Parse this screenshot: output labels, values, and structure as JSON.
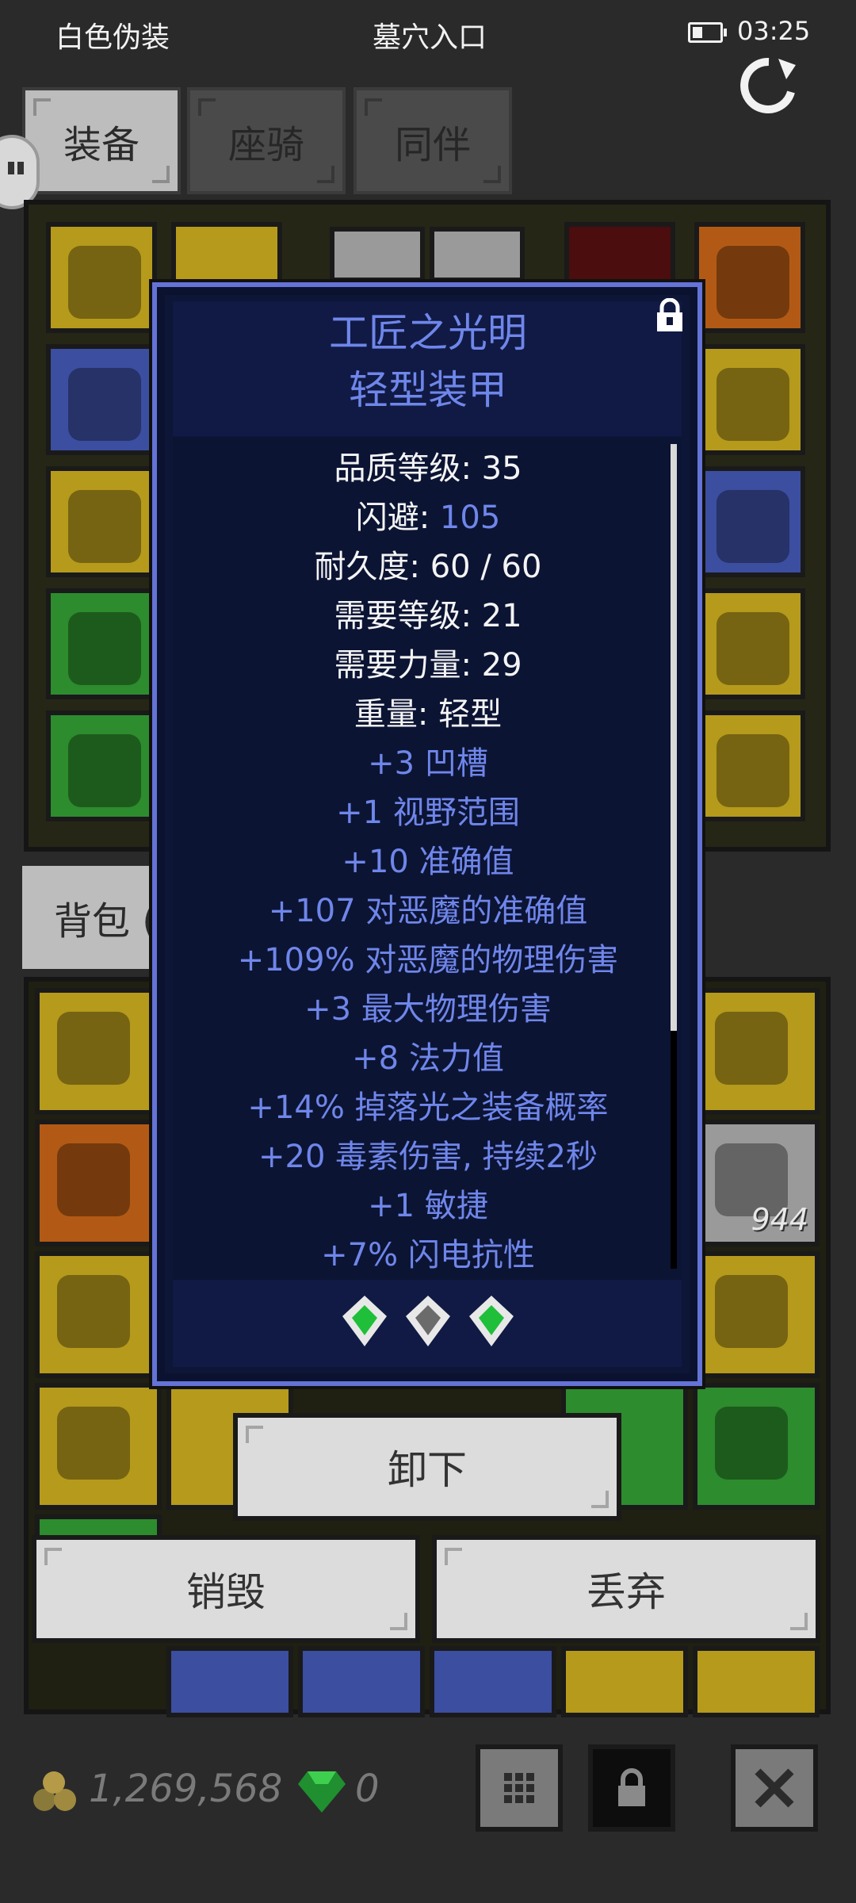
{
  "status_bar": {
    "left_text": "白色伪装",
    "center_text": "墓穴入口",
    "time": "03:25"
  },
  "tabs": [
    {
      "label": "装备",
      "active": true
    },
    {
      "label": "座骑",
      "active": false
    },
    {
      "label": "同伴",
      "active": false
    }
  ],
  "backpack_tab": {
    "label": "背包 ("
  },
  "backpack_items": {
    "fish_quantity": "944"
  },
  "tooltip": {
    "name": "工匠之光明",
    "type": "轻型装甲",
    "stats_white": [
      "品质等级: 35",
      "耐久度: 60 / 60",
      "需要等级: 21",
      "需要力量: 29",
      "重量: 轻型"
    ],
    "evasion_label": "闪避: ",
    "evasion_value": "105",
    "affixes": [
      "+3 凹槽",
      "+1 视野范围",
      "+10 准确值",
      "+107 对恶魔的准确值",
      "+109% 对恶魔的物理伤害",
      "+3 最大物理伤害",
      "+8 法力值",
      "+14% 掉落光之装备概率",
      "+20 毒素伤害, 持续2秒",
      "+1 敏捷",
      "+7% 闪电抗性"
    ],
    "sockets": [
      "green-gem",
      "grey-gem",
      "green-gem"
    ]
  },
  "buttons": {
    "unequip": "卸下",
    "destroy": "销毁",
    "drop": "丢弃"
  },
  "bottom_bar": {
    "gold": "1,269,568",
    "gems": "0"
  },
  "colors": {
    "accent_blue": "#6f86ea",
    "tooltip_bg": "#0e1638",
    "tooltip_border": "#6573d6"
  }
}
